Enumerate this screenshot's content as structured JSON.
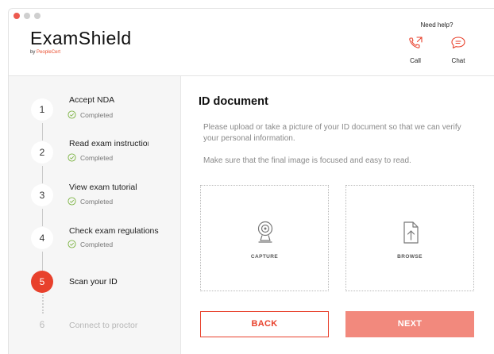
{
  "brand": {
    "name": "ExamShield",
    "by_prefix": "by ",
    "by_company": "PeopleCert"
  },
  "help": {
    "title": "Need help?",
    "call": {
      "label": "Call",
      "icon": "phone-icon"
    },
    "chat": {
      "label": "Chat",
      "icon": "chat-bubble-icon"
    }
  },
  "colors": {
    "accent": "#e8412c",
    "next_disabled": "#f2897d",
    "check": "#7cb342"
  },
  "steps": [
    {
      "number": "1",
      "label": "Accept NDA",
      "status": "Completed",
      "state": "completed"
    },
    {
      "number": "2",
      "label": "Read exam instructions",
      "status": "Completed",
      "state": "completed"
    },
    {
      "number": "3",
      "label": "View exam tutorial",
      "status": "Completed",
      "state": "completed"
    },
    {
      "number": "4",
      "label": "Check exam regulations",
      "status": "Completed",
      "state": "completed"
    },
    {
      "number": "5",
      "label": "Scan your ID",
      "status": "",
      "state": "active"
    },
    {
      "number": "6",
      "label": "Connect to proctor",
      "status": "",
      "state": "disabled"
    }
  ],
  "main": {
    "title": "ID document",
    "instructions": "Please upload or take a picture of your ID document so that we can verify your personal information.",
    "hint": "Make sure that the final image is focused and easy to read.",
    "capture": {
      "label": "CAPTURE",
      "icon": "webcam-icon"
    },
    "browse": {
      "label": "BROWSE",
      "icon": "upload-file-icon"
    },
    "back_label": "BACK",
    "next_label": "NEXT"
  }
}
